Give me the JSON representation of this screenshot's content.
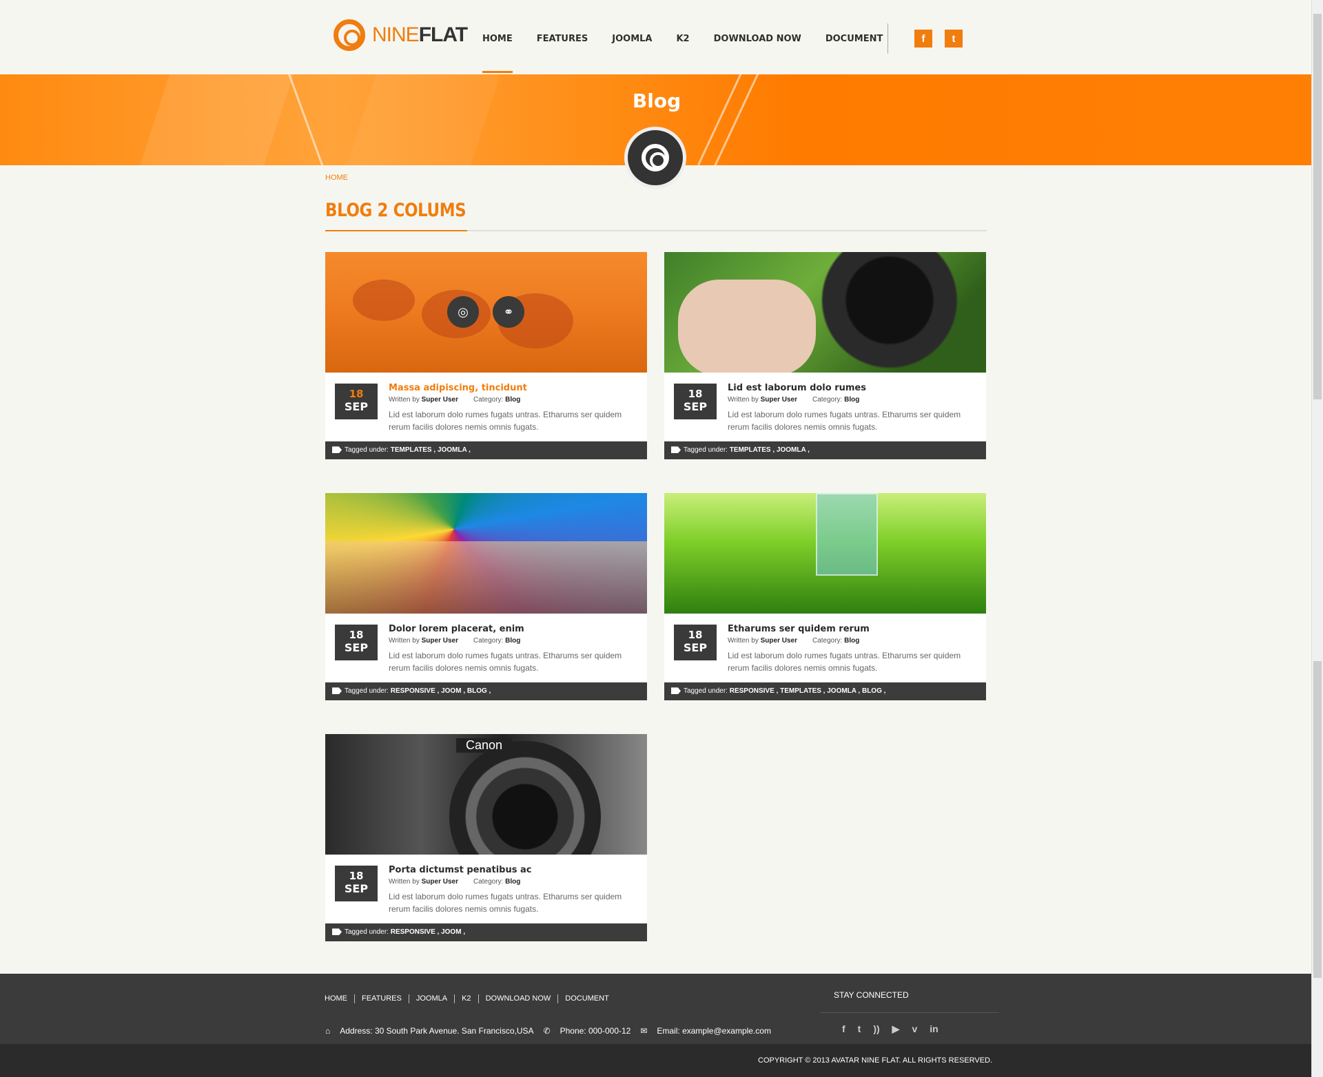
{
  "header": {
    "logo_nine": "NINE",
    "logo_flat": "FLAT",
    "nav": [
      "HOME",
      "FEATURES",
      "JOOMLA",
      "K2",
      "DOWNLOAD NOW",
      "DOCUMENT"
    ],
    "active_nav": "HOME",
    "social": [
      "facebook-icon",
      "twitter-icon"
    ]
  },
  "banner": {
    "title": "Blog"
  },
  "breadcrumb": "HOME",
  "section_title": "BLOG 2 COLUMS",
  "posts": [
    {
      "title": "Massa adipiscing, tincidunt",
      "day": "18",
      "month": "SEP",
      "written_by": "Written by",
      "author": "Super User",
      "category_label": "Category:",
      "category": "Blog",
      "excerpt": "Lid est laborum dolo rumes fugats untras. Etharums ser quidem rerum facilis dolores nemis omnis fugats.",
      "tagged_label": "Tagged under:",
      "tags": "TEMPLATES , JOOMLA ,",
      "image": "ladybug-photo",
      "highlighted": true
    },
    {
      "title": "Lid est laborum dolo rumes",
      "day": "18",
      "month": "SEP",
      "written_by": "Written by",
      "author": "Super User",
      "category_label": "Category:",
      "category": "Blog",
      "excerpt": "Lid est laborum dolo rumes fugats untras. Etharums ser quidem rerum facilis dolores nemis omnis fugats.",
      "tagged_label": "Tagged under:",
      "tags": "TEMPLATES , JOOMLA ,",
      "image": "camera-lens-photo"
    },
    {
      "title": "Dolor lorem placerat, enim",
      "day": "18",
      "month": "SEP",
      "written_by": "Written by",
      "author": "Super User",
      "category_label": "Category:",
      "category": "Blog",
      "excerpt": "Lid est laborum dolo rumes fugats untras. Etharums ser quidem rerum facilis dolores nemis omnis fugats.",
      "tagged_label": "Tagged under:",
      "tags": "RESPONSIVE , JOOM , BLOG ,",
      "image": "umbrella-photo"
    },
    {
      "title": "Etharums ser quidem rerum",
      "day": "18",
      "month": "SEP",
      "written_by": "Written by",
      "author": "Super User",
      "category_label": "Category:",
      "category": "Blog",
      "excerpt": "Lid est laborum dolo rumes fugats untras. Etharums ser quidem rerum facilis dolores nemis omnis fugats.",
      "tagged_label": "Tagged under:",
      "tags": "RESPONSIVE , TEMPLATES , JOOMLA , BLOG ,",
      "image": "grass-glass-photo"
    },
    {
      "title": "Porta dictumst penatibus ac",
      "day": "18",
      "month": "SEP",
      "written_by": "Written by",
      "author": "Super User",
      "category_label": "Category:",
      "category": "Blog",
      "excerpt": "Lid est laborum dolo rumes fugats untras. Etharums ser quidem rerum facilis dolores nemis omnis fugats.",
      "tagged_label": "Tagged under:",
      "tags": "RESPONSIVE , JOOM ,",
      "image": "canon-camera-photo",
      "image_text": "Canon"
    }
  ],
  "footer": {
    "nav": [
      "HOME",
      "FEATURES",
      "JOOMLA",
      "K2",
      "DOWNLOAD NOW",
      "DOCUMENT"
    ],
    "address": "Address: 30 South Park Avenue. San Francisco,USA",
    "phone": "Phone: 000-000-12",
    "email": "Email: example@example.com",
    "stay_connected": "STAY CONNECTED",
    "social": [
      "facebook-icon",
      "twitter-icon",
      "rss-icon",
      "youtube-icon",
      "vimeo-icon",
      "linkedin-icon"
    ],
    "copyright": "COPYRIGHT © 2013 AVATAR NINE FLAT. ALL RIGHTS RESERVED."
  },
  "colors": {
    "accent": "#f07d0e",
    "dark": "#3b3b3b",
    "background": "#f6f6f1"
  }
}
